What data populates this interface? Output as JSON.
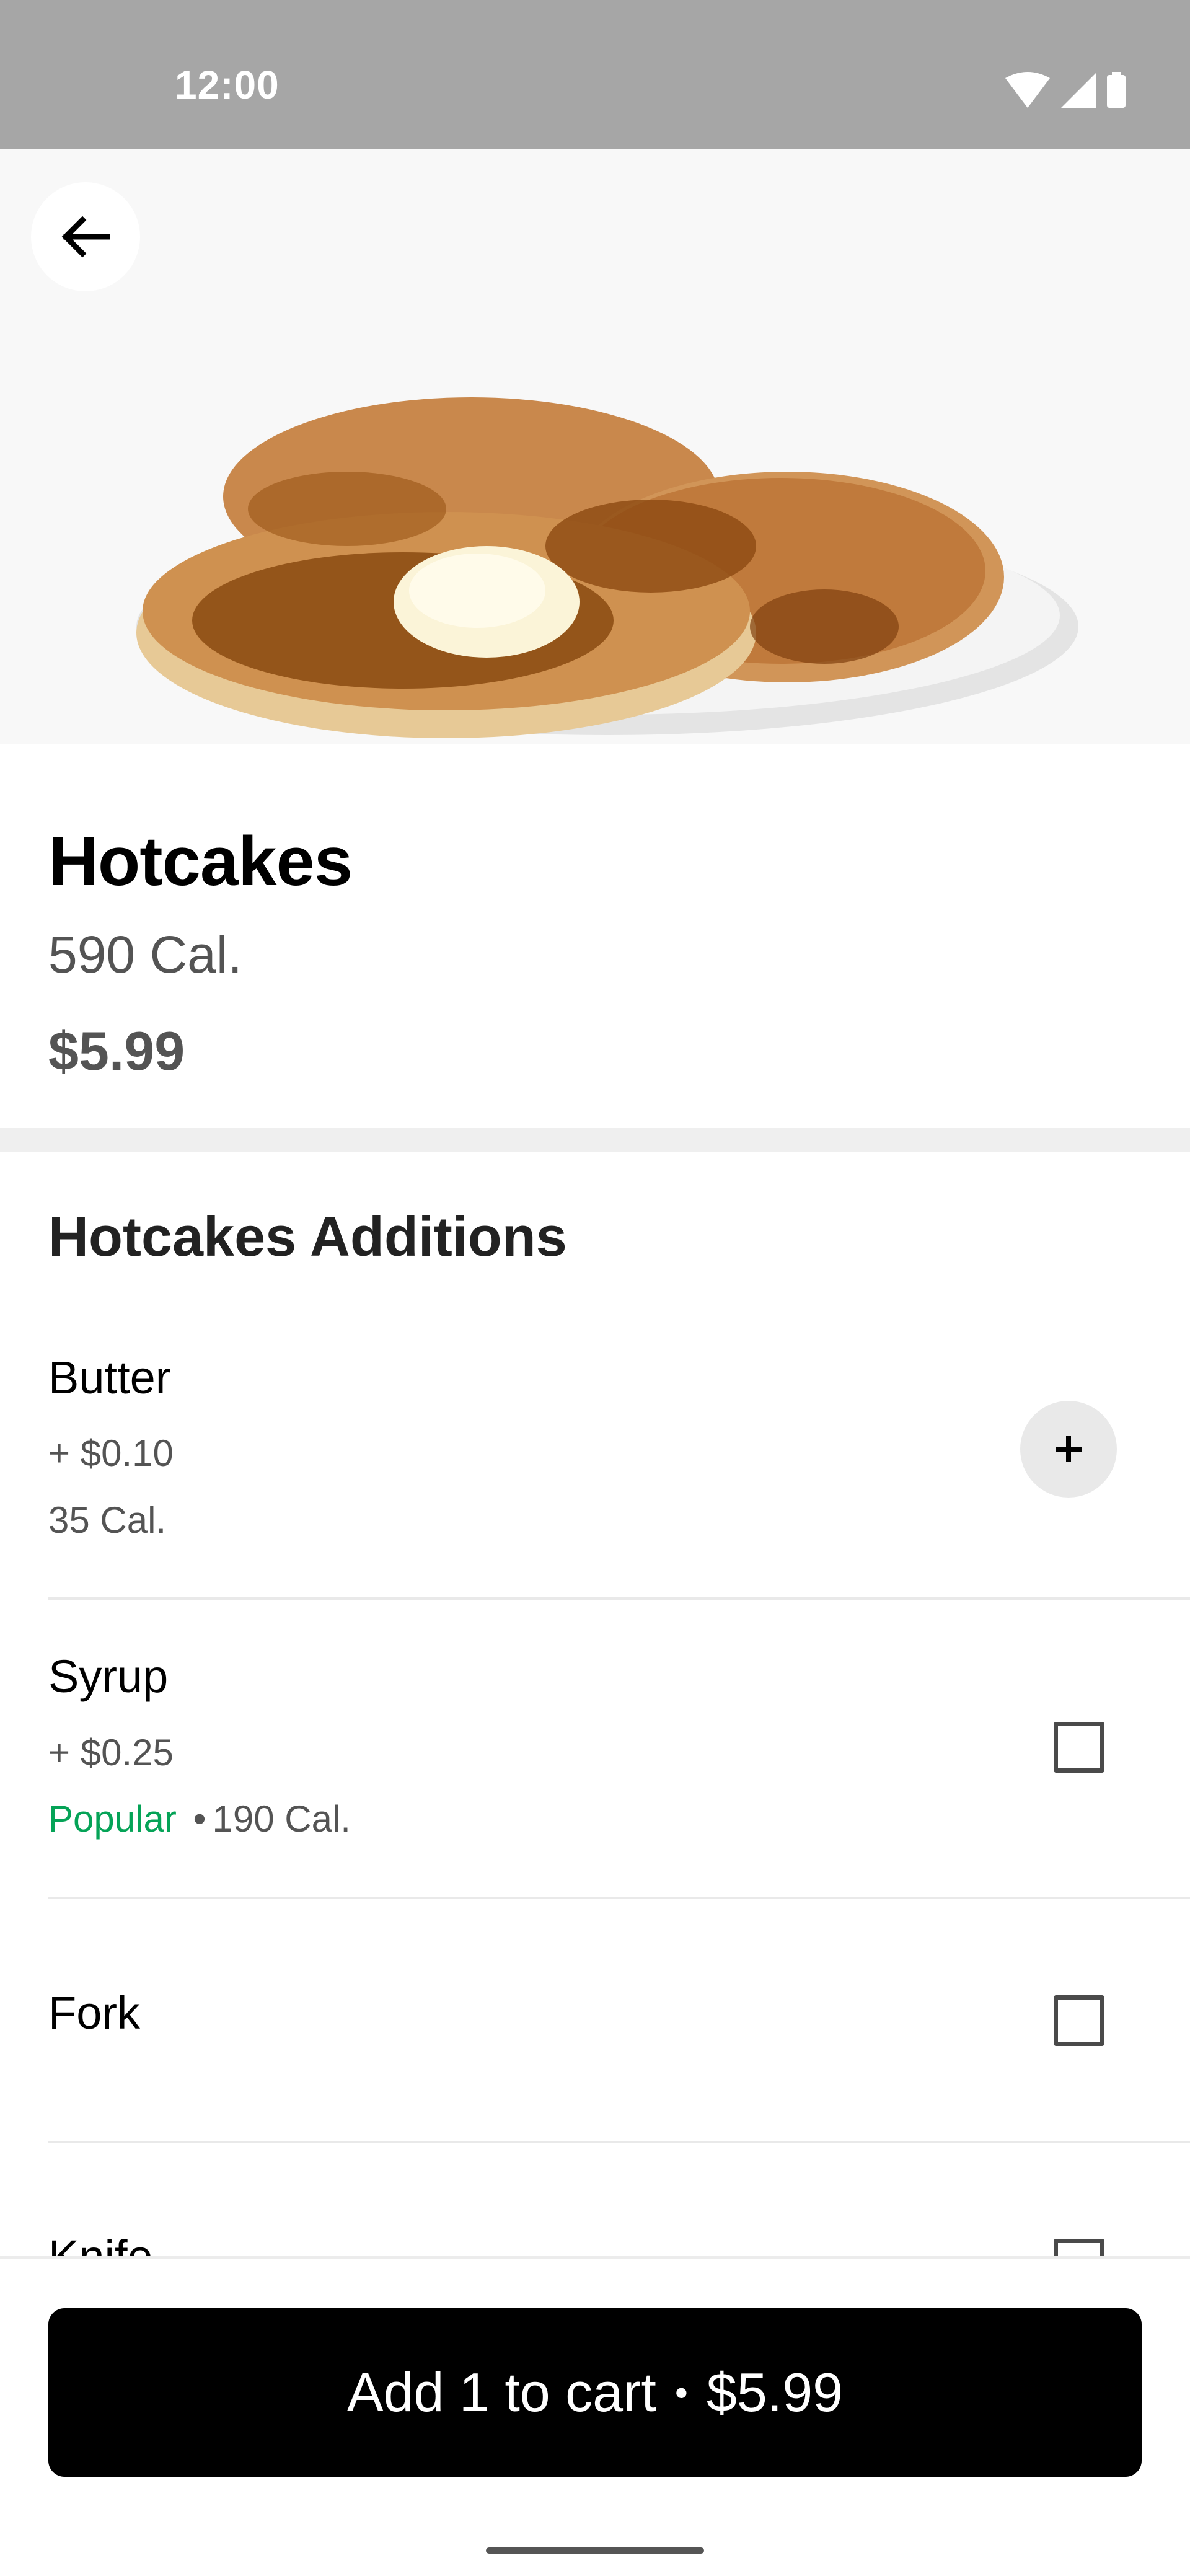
{
  "status_bar": {
    "time": "12:00",
    "icons": [
      "wifi-icon",
      "signal-icon",
      "battery-icon"
    ]
  },
  "header": {
    "back_icon": "arrow-left-icon"
  },
  "item": {
    "name": "Hotcakes",
    "calories": "590 Cal.",
    "price": "$5.99"
  },
  "additions": {
    "title": "Hotcakes Additions",
    "options": [
      {
        "name": "Butter",
        "price": "+ $0.10",
        "detail": "35 Cal.",
        "control": "plus-button"
      },
      {
        "name": "Syrup",
        "price": "+ $0.25",
        "popular": "Popular",
        "separator": "•",
        "detail": "190 Cal.",
        "control": "checkbox",
        "checked": false
      },
      {
        "name": "Fork",
        "control": "checkbox",
        "checked": false
      },
      {
        "name": "Knife",
        "control": "checkbox",
        "checked": false
      }
    ]
  },
  "cart_button": {
    "label": "Add 1 to cart",
    "separator": "•",
    "price": "$5.99"
  },
  "colors": {
    "status_bar": "#a6a6a6",
    "popular_green": "#05a357",
    "primary_button": "#000000",
    "muted_text": "#545454"
  }
}
